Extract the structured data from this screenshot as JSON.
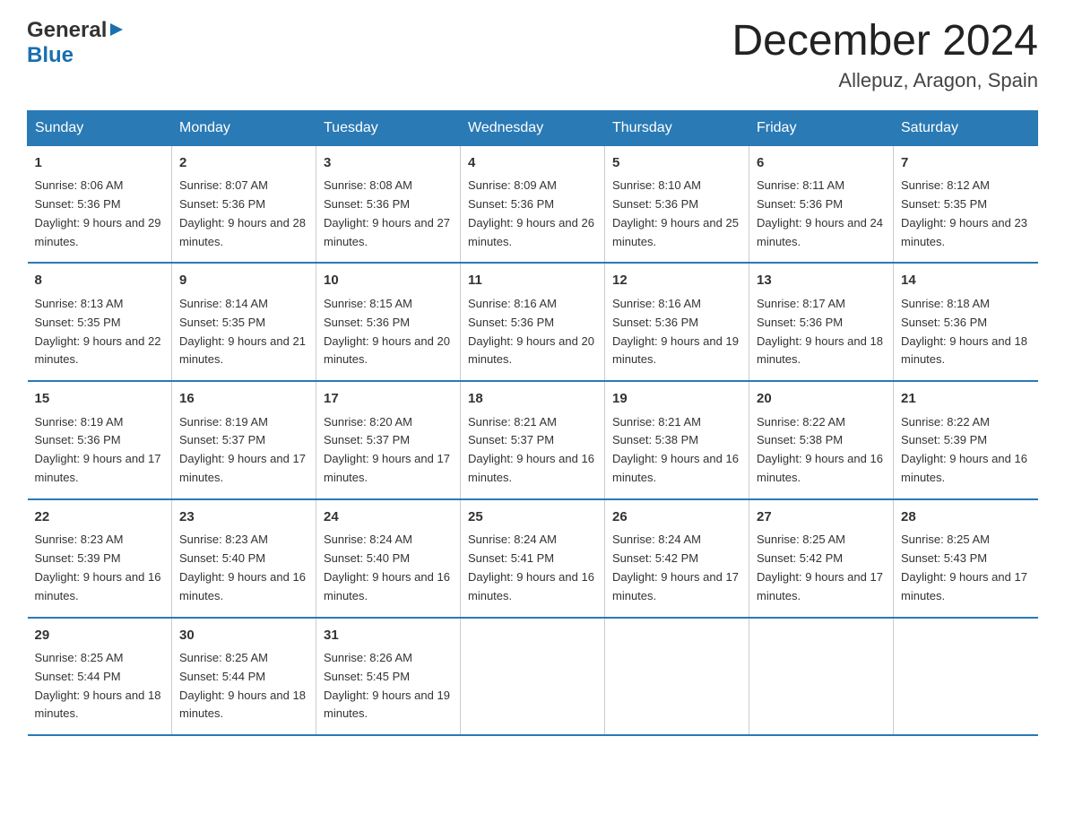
{
  "logo": {
    "general": "General",
    "blue": "Blue",
    "arrow": "▶"
  },
  "title": {
    "month_year": "December 2024",
    "location": "Allepuz, Aragon, Spain"
  },
  "days_of_week": [
    "Sunday",
    "Monday",
    "Tuesday",
    "Wednesday",
    "Thursday",
    "Friday",
    "Saturday"
  ],
  "weeks": [
    [
      {
        "day": "1",
        "sunrise": "8:06 AM",
        "sunset": "5:36 PM",
        "daylight": "9 hours and 29 minutes."
      },
      {
        "day": "2",
        "sunrise": "8:07 AM",
        "sunset": "5:36 PM",
        "daylight": "9 hours and 28 minutes."
      },
      {
        "day": "3",
        "sunrise": "8:08 AM",
        "sunset": "5:36 PM",
        "daylight": "9 hours and 27 minutes."
      },
      {
        "day": "4",
        "sunrise": "8:09 AM",
        "sunset": "5:36 PM",
        "daylight": "9 hours and 26 minutes."
      },
      {
        "day": "5",
        "sunrise": "8:10 AM",
        "sunset": "5:36 PM",
        "daylight": "9 hours and 25 minutes."
      },
      {
        "day": "6",
        "sunrise": "8:11 AM",
        "sunset": "5:36 PM",
        "daylight": "9 hours and 24 minutes."
      },
      {
        "day": "7",
        "sunrise": "8:12 AM",
        "sunset": "5:35 PM",
        "daylight": "9 hours and 23 minutes."
      }
    ],
    [
      {
        "day": "8",
        "sunrise": "8:13 AM",
        "sunset": "5:35 PM",
        "daylight": "9 hours and 22 minutes."
      },
      {
        "day": "9",
        "sunrise": "8:14 AM",
        "sunset": "5:35 PM",
        "daylight": "9 hours and 21 minutes."
      },
      {
        "day": "10",
        "sunrise": "8:15 AM",
        "sunset": "5:36 PM",
        "daylight": "9 hours and 20 minutes."
      },
      {
        "day": "11",
        "sunrise": "8:16 AM",
        "sunset": "5:36 PM",
        "daylight": "9 hours and 20 minutes."
      },
      {
        "day": "12",
        "sunrise": "8:16 AM",
        "sunset": "5:36 PM",
        "daylight": "9 hours and 19 minutes."
      },
      {
        "day": "13",
        "sunrise": "8:17 AM",
        "sunset": "5:36 PM",
        "daylight": "9 hours and 18 minutes."
      },
      {
        "day": "14",
        "sunrise": "8:18 AM",
        "sunset": "5:36 PM",
        "daylight": "9 hours and 18 minutes."
      }
    ],
    [
      {
        "day": "15",
        "sunrise": "8:19 AM",
        "sunset": "5:36 PM",
        "daylight": "9 hours and 17 minutes."
      },
      {
        "day": "16",
        "sunrise": "8:19 AM",
        "sunset": "5:37 PM",
        "daylight": "9 hours and 17 minutes."
      },
      {
        "day": "17",
        "sunrise": "8:20 AM",
        "sunset": "5:37 PM",
        "daylight": "9 hours and 17 minutes."
      },
      {
        "day": "18",
        "sunrise": "8:21 AM",
        "sunset": "5:37 PM",
        "daylight": "9 hours and 16 minutes."
      },
      {
        "day": "19",
        "sunrise": "8:21 AM",
        "sunset": "5:38 PM",
        "daylight": "9 hours and 16 minutes."
      },
      {
        "day": "20",
        "sunrise": "8:22 AM",
        "sunset": "5:38 PM",
        "daylight": "9 hours and 16 minutes."
      },
      {
        "day": "21",
        "sunrise": "8:22 AM",
        "sunset": "5:39 PM",
        "daylight": "9 hours and 16 minutes."
      }
    ],
    [
      {
        "day": "22",
        "sunrise": "8:23 AM",
        "sunset": "5:39 PM",
        "daylight": "9 hours and 16 minutes."
      },
      {
        "day": "23",
        "sunrise": "8:23 AM",
        "sunset": "5:40 PM",
        "daylight": "9 hours and 16 minutes."
      },
      {
        "day": "24",
        "sunrise": "8:24 AM",
        "sunset": "5:40 PM",
        "daylight": "9 hours and 16 minutes."
      },
      {
        "day": "25",
        "sunrise": "8:24 AM",
        "sunset": "5:41 PM",
        "daylight": "9 hours and 16 minutes."
      },
      {
        "day": "26",
        "sunrise": "8:24 AM",
        "sunset": "5:42 PM",
        "daylight": "9 hours and 17 minutes."
      },
      {
        "day": "27",
        "sunrise": "8:25 AM",
        "sunset": "5:42 PM",
        "daylight": "9 hours and 17 minutes."
      },
      {
        "day": "28",
        "sunrise": "8:25 AM",
        "sunset": "5:43 PM",
        "daylight": "9 hours and 17 minutes."
      }
    ],
    [
      {
        "day": "29",
        "sunrise": "8:25 AM",
        "sunset": "5:44 PM",
        "daylight": "9 hours and 18 minutes."
      },
      {
        "day": "30",
        "sunrise": "8:25 AM",
        "sunset": "5:44 PM",
        "daylight": "9 hours and 18 minutes."
      },
      {
        "day": "31",
        "sunrise": "8:26 AM",
        "sunset": "5:45 PM",
        "daylight": "9 hours and 19 minutes."
      },
      null,
      null,
      null,
      null
    ]
  ]
}
